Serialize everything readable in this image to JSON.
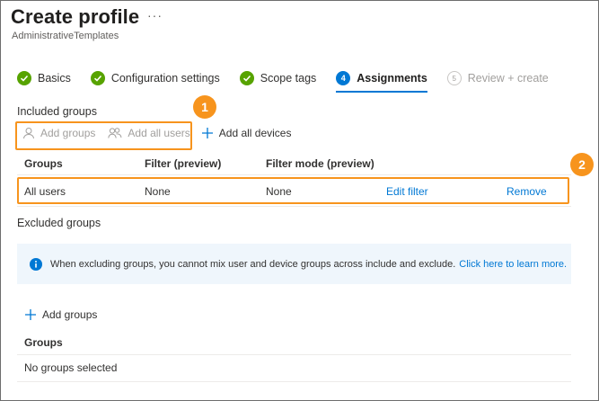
{
  "header": {
    "title": "Create profile",
    "more": "···",
    "subtitle": "AdministrativeTemplates"
  },
  "steps": [
    {
      "label": "Basics",
      "state": "complete",
      "icon": "check-icon"
    },
    {
      "label": "Configuration settings",
      "state": "complete",
      "icon": "check-icon"
    },
    {
      "label": "Scope tags",
      "state": "complete",
      "icon": "check-icon"
    },
    {
      "label": "Assignments",
      "state": "active",
      "number": "4"
    },
    {
      "label": "Review + create",
      "state": "disabled",
      "number": "5"
    }
  ],
  "included": {
    "title": "Included groups",
    "add_groups": "Add groups",
    "add_all_users": "Add all users",
    "add_all_devices": "Add all devices",
    "columns": [
      "Groups",
      "Filter (preview)",
      "Filter mode (preview)"
    ],
    "row": {
      "group": "All users",
      "filter": "None",
      "filter_mode": "None",
      "edit_filter": "Edit filter",
      "remove": "Remove"
    }
  },
  "excluded": {
    "title": "Excluded groups",
    "info_text": "When excluding groups, you cannot mix user and device groups across include and exclude.",
    "info_link": "Click here to learn more.",
    "add_groups": "Add groups",
    "column": "Groups",
    "empty": "No groups selected"
  },
  "callouts": [
    "1",
    "2"
  ],
  "colors": {
    "accent": "#0078d4",
    "success": "#57a300",
    "highlight": "#f7941d",
    "info_bg": "#eff6fc"
  }
}
